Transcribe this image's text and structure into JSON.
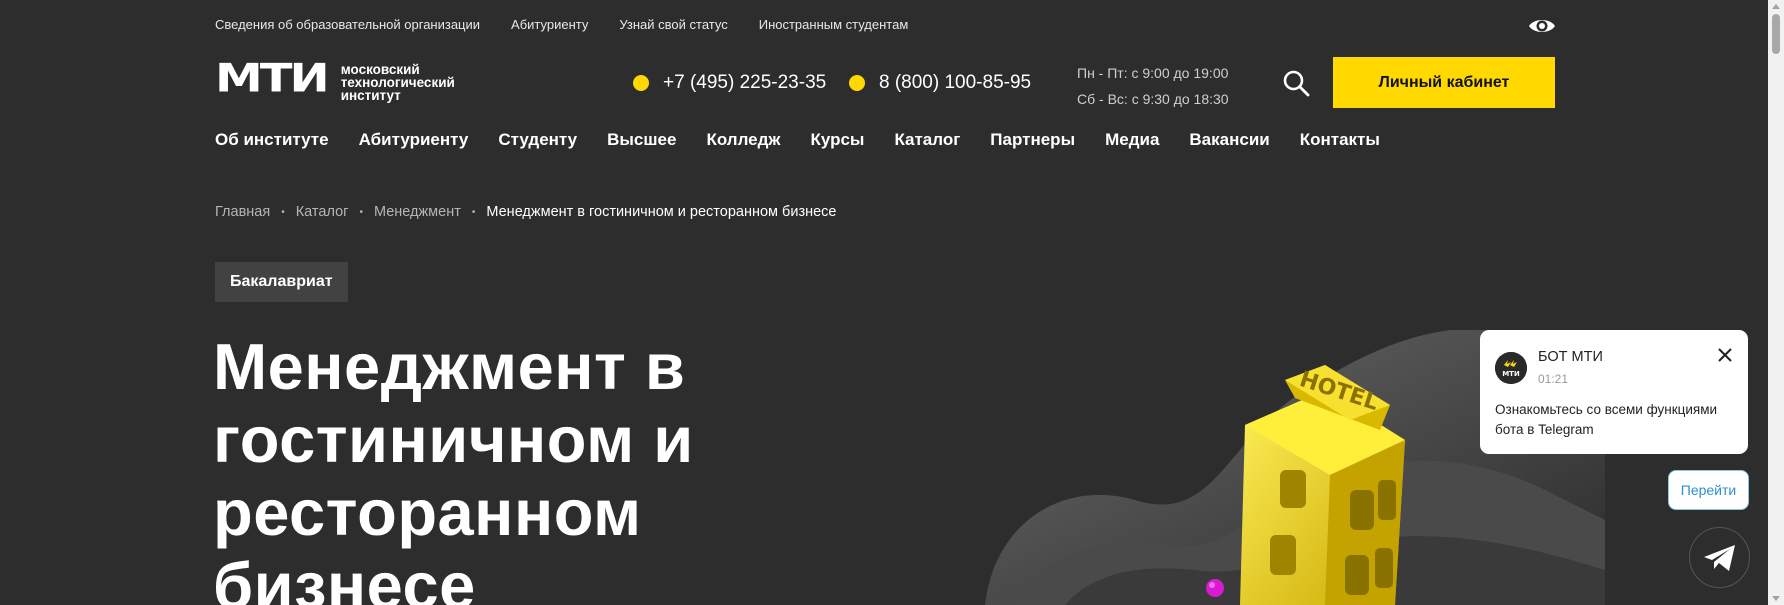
{
  "topbar": {
    "links": [
      "Сведения об образовательной организации",
      "Абитуриенту",
      "Узнай свой статус",
      "Иностранным студентам"
    ]
  },
  "logo": {
    "mark": "МТИ",
    "line1": "московский",
    "line2": "технологический",
    "line3": "институт"
  },
  "contacts": {
    "phone1": "+7 (495) 225-23-35",
    "phone2": "8 (800) 100-85-95",
    "hours_weekdays": "Пн - Пт: с 9:00 до 19:00",
    "hours_weekend": "Сб - Вс: с 9:30 до 18:30"
  },
  "header": {
    "cabinet_label": "Личный кабинет"
  },
  "nav": {
    "items": [
      "Об институте",
      "Абитуриенту",
      "Студенту",
      "Высшее",
      "Колледж",
      "Курсы",
      "Каталог",
      "Партнеры",
      "Медиа",
      "Вакансии",
      "Контакты"
    ]
  },
  "breadcrumb": {
    "items": [
      "Главная",
      "Каталог",
      "Менеджмент"
    ],
    "current": "Менеджмент в гостиничном и ресторанном бизнесе"
  },
  "program": {
    "badge": "Бакалавриат",
    "title": "Менеджмент в гостиничном и ресторанном бизнесе"
  },
  "hero": {
    "sign_text": "HOTEL"
  },
  "bot": {
    "name": "БОТ МТИ",
    "time": "01:21",
    "message": "Ознакомьтесь со всеми функциями бота в Telegram",
    "go_label": "Перейти",
    "avatar_text": "МТИ"
  },
  "colors": {
    "background": "#2d2d2d",
    "accent": "#ffd800",
    "text": "#ffffff",
    "link_blue": "#2f8fcd"
  },
  "icons": {
    "accessibility": "eye-icon",
    "search": "search-icon",
    "close": "close-icon",
    "telegram": "telegram-icon"
  }
}
